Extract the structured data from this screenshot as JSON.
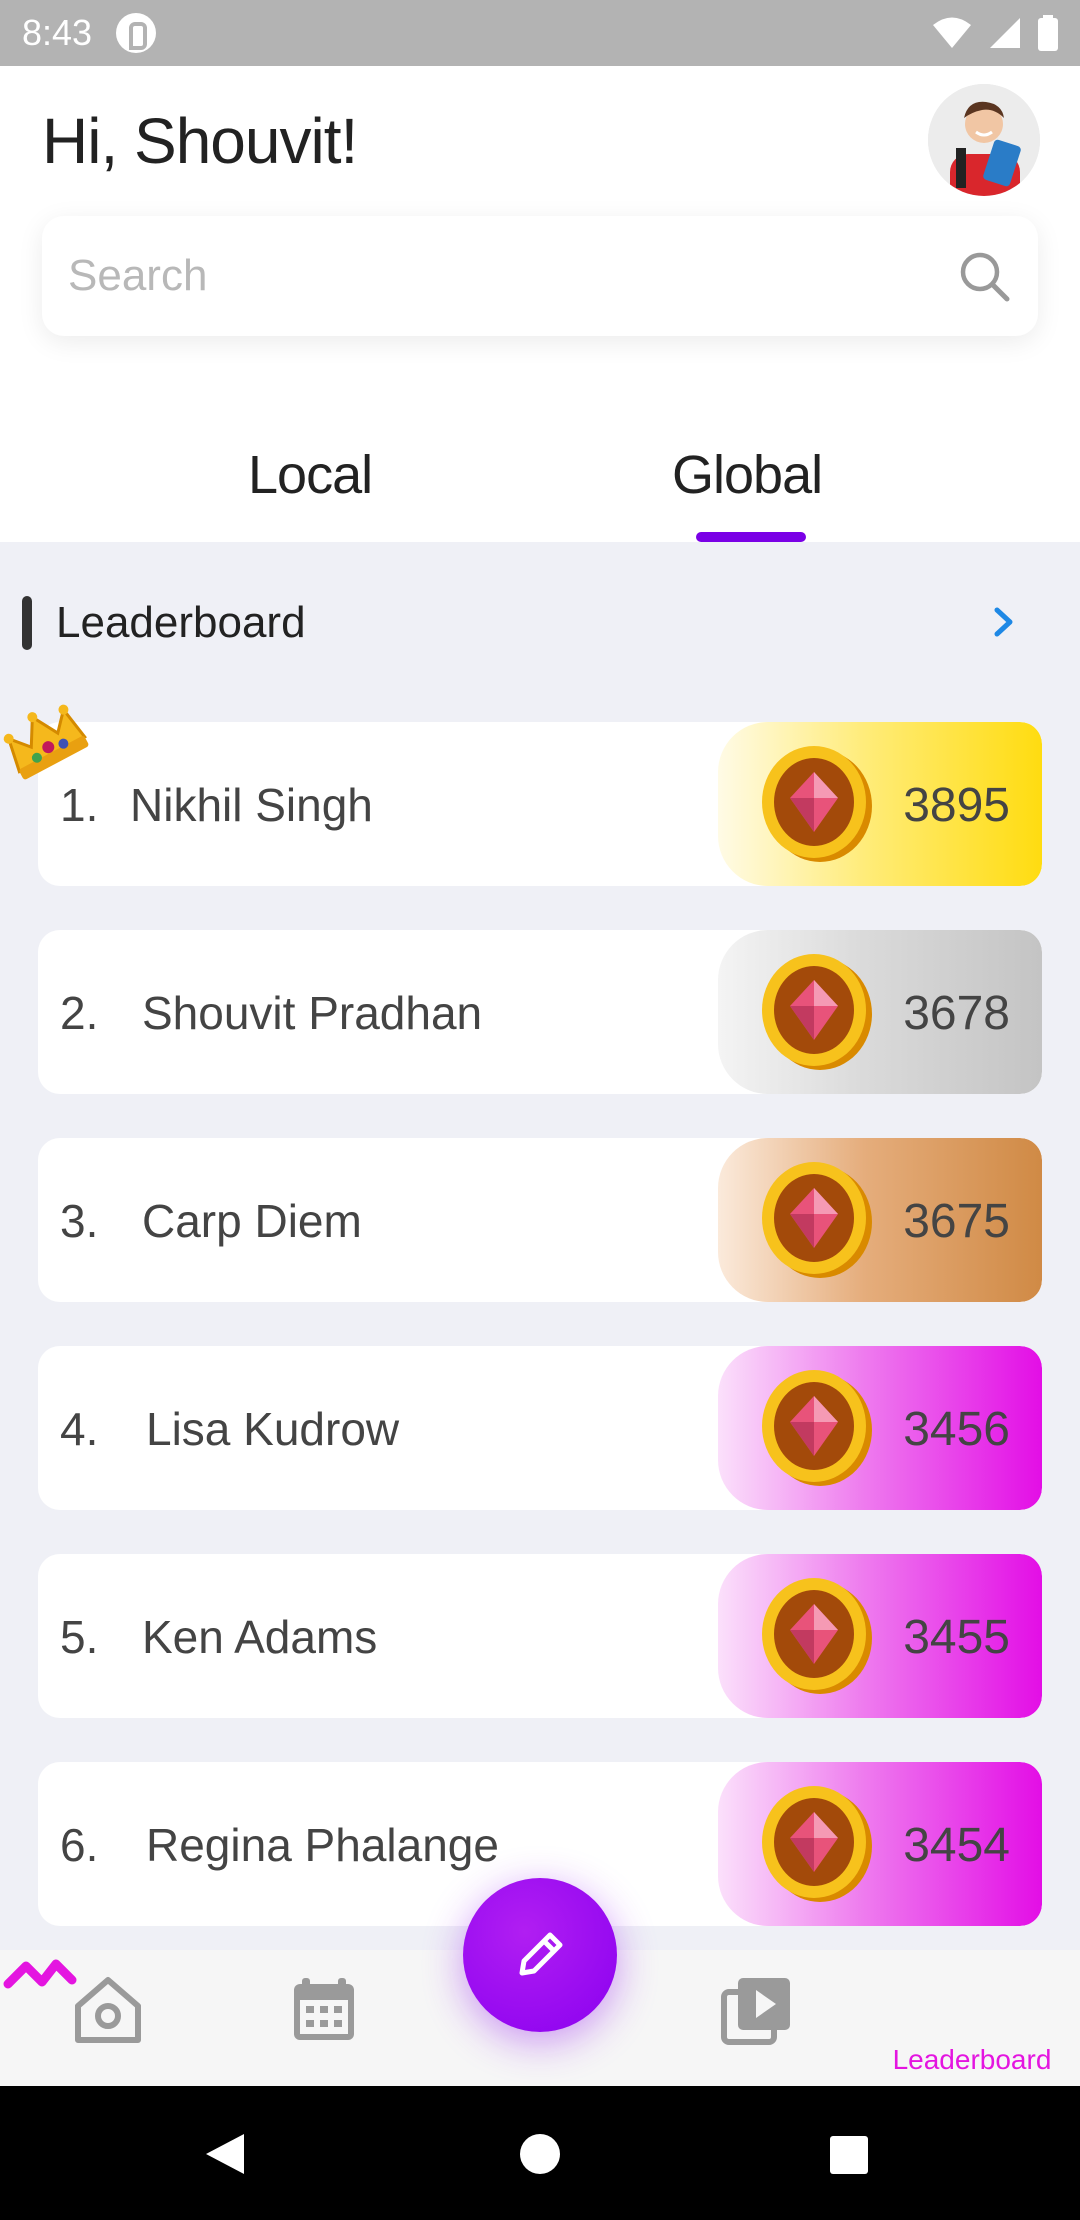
{
  "status_bar": {
    "time": "8:43"
  },
  "header": {
    "greeting": "Hi, Shouvit!",
    "search": {
      "placeholder": "Search",
      "value": ""
    }
  },
  "tabs": [
    {
      "label": "Local",
      "selected": false
    },
    {
      "label": "Global",
      "selected": true
    }
  ],
  "section": {
    "title": "Leaderboard"
  },
  "leaderboard": [
    {
      "rank": "1.",
      "name": "Nikhil Singh",
      "score": "3895",
      "tier": "gold"
    },
    {
      "rank": "2.",
      "name": "Shouvit Pradhan",
      "score": "3678",
      "tier": "silver"
    },
    {
      "rank": "3.",
      "name": "Carp Diem",
      "score": "3675",
      "tier": "bronze"
    },
    {
      "rank": "4.",
      "name": "Lisa Kudrow",
      "score": "3456",
      "tier": "magenta"
    },
    {
      "rank": "5.",
      "name": "Ken Adams",
      "score": "3455",
      "tier": "magenta"
    },
    {
      "rank": "6.",
      "name": "Regina Phalange",
      "score": "3454",
      "tier": "magenta"
    }
  ],
  "tier_colors": {
    "gold": "#ffdc10",
    "silver": "#c4c4c4",
    "bronze": "#d08a45",
    "magenta": "#e30ee6"
  },
  "bottom_nav": {
    "items": [
      "home-icon",
      "calendar-icon",
      "video-library-icon",
      "leaderboard-icon"
    ],
    "active_label": "Leaderboard"
  },
  "colors": {
    "accent_purple": "#7a00e6",
    "leaderboard_pink": "#e415e0",
    "chevron_blue": "#1e88e5"
  }
}
